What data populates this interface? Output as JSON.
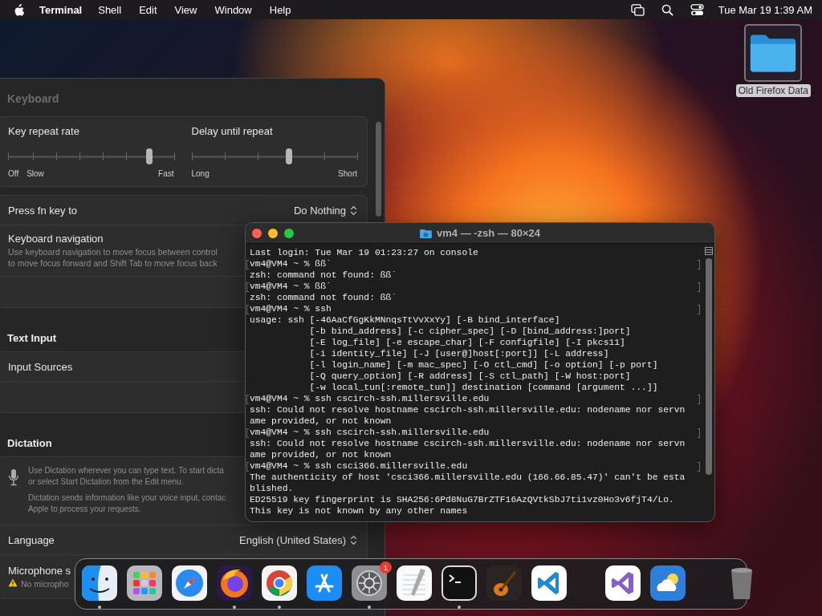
{
  "menu_bar": {
    "app_name": "Terminal",
    "menus": [
      "Shell",
      "Edit",
      "View",
      "Window",
      "Help"
    ],
    "clock": "Tue Mar 19  1:39 AM"
  },
  "desktop_items": [
    {
      "label": "Old Firefox Data",
      "selected": true
    }
  ],
  "settings": {
    "title": "Keyboard",
    "sections": [
      {
        "rows": [
          {
            "kind": "sliders",
            "sliders": [
              {
                "kind": "rate",
                "label": "Key repeat rate",
                "level": 0.85,
                "min_labels": [
                  "Off",
                  "Slow"
                ],
                "max_label": "Fast"
              },
              {
                "kind": "delay",
                "label": "Delay until repeat",
                "level": 0.59,
                "min_labels": [
                  "Long"
                ],
                "max_label": "Short"
              }
            ]
          }
        ]
      },
      {
        "rows": [
          {
            "kind": "popup",
            "label": "Press fn key to",
            "value": "Do Nothing"
          },
          {
            "kind": "info",
            "label": "Keyboard navigation",
            "lines": [
              "Use keyboard navigation to move focus between control",
              "to move focus forward and Shift Tab to move focus back"
            ]
          },
          {
            "kind": "blank"
          }
        ]
      },
      {
        "heading": "Text Input",
        "rows": [
          {
            "kind": "plain",
            "label": "Input Sources"
          },
          {
            "kind": "blank"
          }
        ]
      },
      {
        "heading": "Dictation",
        "rows": [
          {
            "kind": "dictation",
            "paragraphs": [
              [
                "Use Dictation wherever you can type text. To start dicta",
                "or select Start Dictation from the Edit menu."
              ],
              [
                "Dictation sends information like your voice input, contac",
                "Apple to process your requests."
              ]
            ]
          },
          {
            "kind": "popup",
            "label": "Language",
            "value": "English (United States)"
          },
          {
            "kind": "warning",
            "label": "Microphone s",
            "warning": "No micropho"
          }
        ]
      }
    ]
  },
  "terminal": {
    "title": "vm4 — -zsh — 80×24",
    "lines": [
      {
        "kind": "output",
        "text": "Last login: Tue Mar 19 01:23:27 on console"
      },
      {
        "kind": "prompt",
        "text": "vm4@VM4 ~ % ßß˙"
      },
      {
        "kind": "output",
        "text": "zsh: command not found: ßß˙"
      },
      {
        "kind": "prompt",
        "text": "vm4@VM4 ~ % ßß˙"
      },
      {
        "kind": "output",
        "text": "zsh: command not found: ßß˙"
      },
      {
        "kind": "prompt",
        "text": "vm4@VM4 ~ % ssh"
      },
      {
        "kind": "output",
        "text": "usage: ssh [-46AaCfGgKkMNnqsTtVvXxYy] [-B bind_interface]"
      },
      {
        "kind": "indented",
        "text": "[-b bind_address] [-c cipher_spec] [-D [bind_address:]port]"
      },
      {
        "kind": "indented",
        "text": "[-E log_file] [-e escape_char] [-F configfile] [-I pkcs11]"
      },
      {
        "kind": "indented",
        "text": "[-i identity_file] [-J [user@]host[:port]] [-L address]"
      },
      {
        "kind": "indented",
        "text": "[-l login_name] [-m mac_spec] [-O ctl_cmd] [-o option] [-p port]"
      },
      {
        "kind": "indented",
        "text": "[-Q query_option] [-R address] [-S ctl_path] [-W host:port]"
      },
      {
        "kind": "indented",
        "text": "[-w local_tun[:remote_tun]] destination [command [argument ...]]"
      },
      {
        "kind": "prompt",
        "text": "vm4@VM4 ~ % ssh cscirch-ssh.millersville.edu"
      },
      {
        "kind": "output",
        "text": "ssh: Could not resolve hostname cscirch-ssh.millersville.edu: nodename nor servn"
      },
      {
        "kind": "output",
        "text": "ame provided, or not known"
      },
      {
        "kind": "prompt",
        "text": "vm4@VM4 ~ % ssh cscirch-ssh.millersville.edu"
      },
      {
        "kind": "output",
        "text": "ssh: Could not resolve hostname cscirch-ssh.millersville.edu: nodename nor servn"
      },
      {
        "kind": "output",
        "text": "ame provided, or not known"
      },
      {
        "kind": "prompt",
        "text": "vm4@VM4 ~ % ssh csci366.millersville.edu"
      },
      {
        "kind": "output",
        "text": "The authenticity of host 'csci366.millersville.edu (166.66.85.47)' can't be esta"
      },
      {
        "kind": "output",
        "text": "blished."
      },
      {
        "kind": "output",
        "text": "ED25519 key fingerprint is SHA256:6Pd8NuG7BrZTF16AzQVtkSbJ7ti1vz0Ho3v6fjT4/Lo."
      },
      {
        "kind": "output",
        "text": "This key is not known by any other names"
      }
    ]
  },
  "dock": [
    {
      "kind": "finder",
      "running": true
    },
    {
      "kind": "launchpad",
      "running": false
    },
    {
      "kind": "safari",
      "running": false
    },
    {
      "kind": "firefox",
      "running": true
    },
    {
      "kind": "chrome",
      "running": true
    },
    {
      "kind": "appstore",
      "running": false
    },
    {
      "kind": "settings",
      "running": true,
      "badge": "1"
    },
    {
      "kind": "textedit",
      "running": false
    },
    {
      "kind": "terminal",
      "running": true
    },
    {
      "kind": "garageband",
      "running": false
    },
    {
      "kind": "vscode",
      "running": false
    },
    {
      "kind": "separator"
    },
    {
      "kind": "visualstudio",
      "running": false
    },
    {
      "kind": "weather",
      "running": false
    },
    {
      "kind": "separator"
    },
    {
      "kind": "trash",
      "running": false
    }
  ]
}
